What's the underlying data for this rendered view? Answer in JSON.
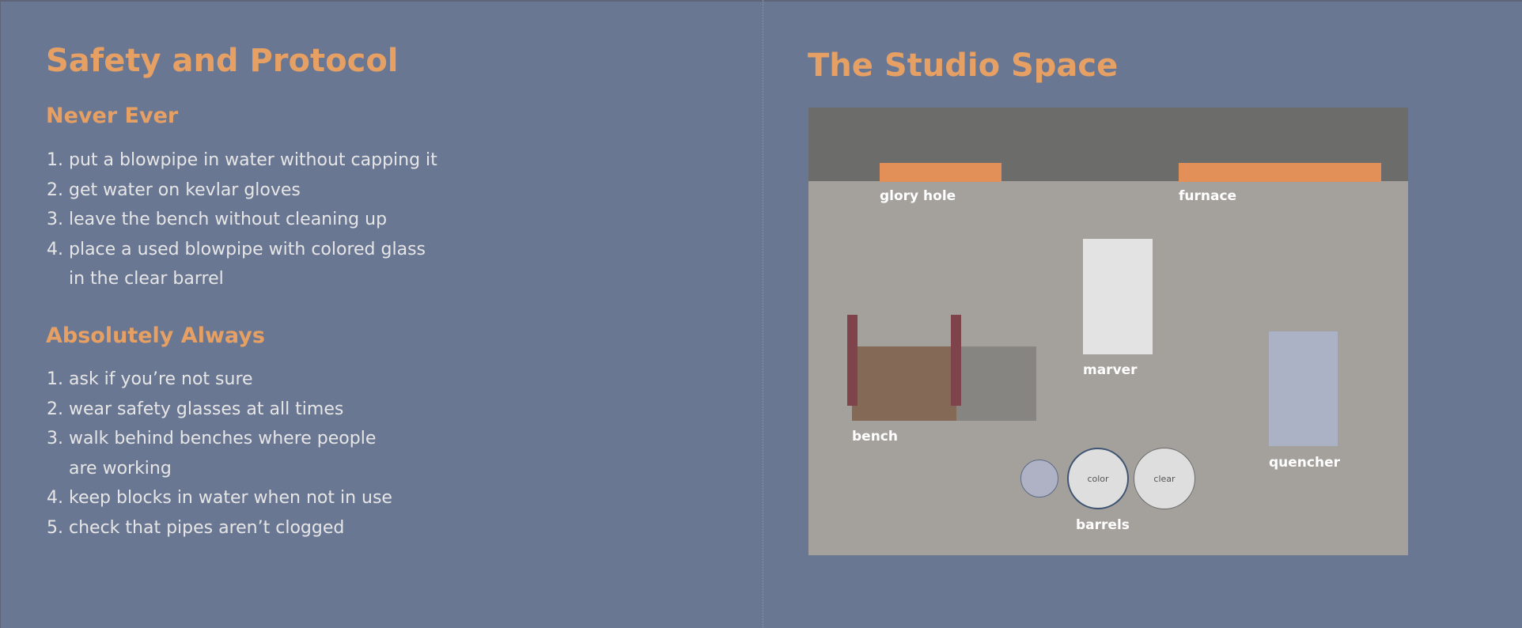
{
  "safety": {
    "title": "Safety and Protocol",
    "never": {
      "heading": "Never Ever",
      "items": [
        "put a blowpipe in water without capping it",
        "get water on kevlar gloves",
        "leave the bench without cleaning up",
        "place a used blowpipe with colored glass in the clear barrel"
      ]
    },
    "always": {
      "heading": "Absolutely Always",
      "items": [
        "ask if you’re not sure",
        "wear safety glasses at all times",
        "walk behind benches where people are working",
        "keep blocks in water when not in use",
        "check that pipes aren’t clogged"
      ]
    }
  },
  "studio": {
    "title": "The Studio Space",
    "labels": {
      "glory_hole": "glory hole",
      "furnace": "furnace",
      "marver": "marver",
      "bench": "bench",
      "quencher": "quencher",
      "barrels": "barrels",
      "barrel_color": "color",
      "barrel_clear": "clear"
    }
  },
  "colors": {
    "background": "#6a7793",
    "accent": "#e7a063",
    "floor": "#a4a19d",
    "wall": "#6c6c6a",
    "oven": "#e38f58",
    "bench_seat": "#846957",
    "bench_rails": "#7f434c",
    "bench_table": "#878581",
    "marver": "#e3e3e3",
    "quencher": "#acb2c6",
    "barrel_fill": "#dedede",
    "barrel_small": "#aeb2c4"
  }
}
